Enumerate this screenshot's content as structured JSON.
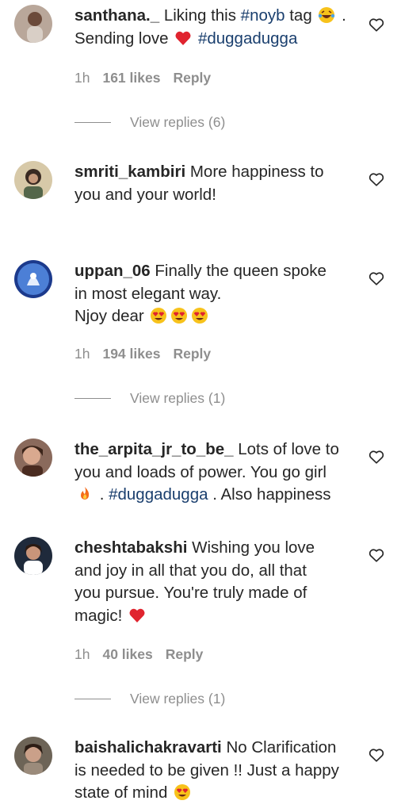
{
  "comments": [
    {
      "username": "santhana._",
      "lines": [
        {
          "text": "Liking this ",
          "tag": "#noyb",
          "tail": " tag"
        },
        {
          "text": "Sending love ",
          "tag": "#duggadugga",
          "tail": ""
        }
      ],
      "time": "1h",
      "likes": "161 likes",
      "reply": "Reply",
      "view_replies": "View replies (6)"
    },
    {
      "username": "smriti_kambiri",
      "text": "More happiness to you and your world!"
    },
    {
      "username": "uppan_06",
      "text_line1": "Finally the queen spoke",
      "text_line2": "in most elegant way.",
      "text_line3": "Njoy dear",
      "time": "1h",
      "likes": "194 likes",
      "reply": "Reply",
      "view_replies": "View replies (1)"
    },
    {
      "username": "the_arpita_jr_to_be_",
      "text_line1": "Lots of love to",
      "text_line2": "you and loads of power. You go girl",
      "tag": "#duggadugga",
      "tail": " . Also happiness"
    },
    {
      "username": "cheshtabakshi",
      "text_line1": "Wishing you love",
      "text_line2": "and joy in all that you do, all that",
      "text_line3": "you pursue. You're truly made of",
      "text_line4": "magic!",
      "time": "1h",
      "likes": "40 likes",
      "reply": "Reply",
      "view_replies": "View replies (1)"
    },
    {
      "username": "baishalichakravarti",
      "text_line1": "No Clarification",
      "text_line2": "is needed to be given !! Just a happy",
      "text_line3": "state of mind"
    }
  ],
  "colors": {
    "text": "#262626",
    "muted": "#8e8e8e",
    "hashtag": "#1a3f6e",
    "heart_emoji": "#e0242f"
  },
  "icons": {
    "like": "heart-outline-icon",
    "emoji_laugh": "laughing-tears-emoji",
    "emoji_heart": "red-heart-emoji",
    "emoji_heart_eyes": "heart-eyes-emoji",
    "emoji_fire": "fire-emoji"
  }
}
